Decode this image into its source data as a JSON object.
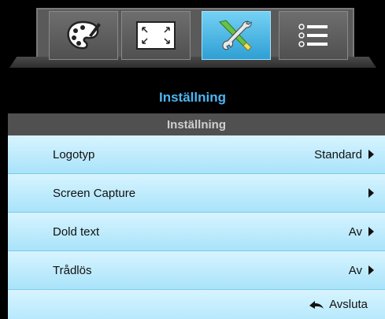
{
  "tabs": [
    {
      "icon": "palette-icon",
      "active": false
    },
    {
      "icon": "fullscreen-icon",
      "active": false
    },
    {
      "icon": "tools-icon",
      "active": true
    },
    {
      "icon": "list-icon",
      "active": false
    }
  ],
  "header": {
    "title": "Inställning"
  },
  "section": {
    "title": "Inställning"
  },
  "menu": {
    "items": [
      {
        "label": "Logotyp",
        "value": "Standard"
      },
      {
        "label": "Screen Capture",
        "value": ""
      },
      {
        "label": "Dold text",
        "value": "Av"
      },
      {
        "label": "Trådlös",
        "value": "Av"
      }
    ]
  },
  "footer": {
    "exit_label": "Avsluta",
    "icon": "back-arrow-icon"
  },
  "colors": {
    "accent": "#4db6f2",
    "row_bg": "#c4ecfc",
    "active_tab": "#3aa9dc"
  }
}
